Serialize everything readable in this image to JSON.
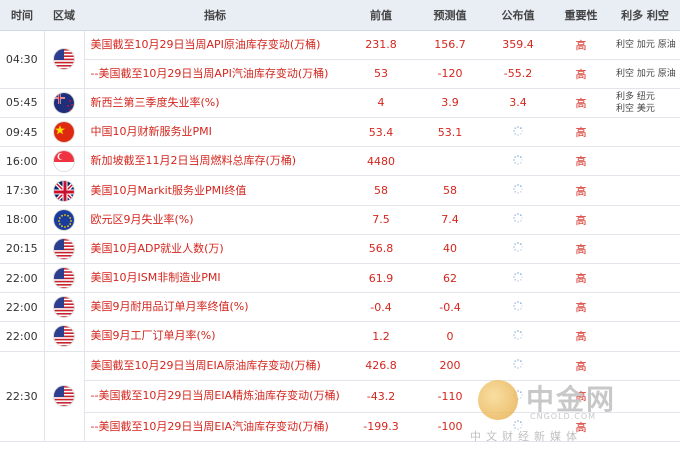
{
  "headers": [
    "时间",
    "区域",
    "指标",
    "前值",
    "预测值",
    "公布值",
    "重要性",
    "利多 利空"
  ],
  "rows": [
    {
      "time": "04:30",
      "flag": "us-flag-icon",
      "indicator": "美国截至10月29日当周API原油库存变动(万桶)",
      "prev": "231.8",
      "forecast": "156.7",
      "actual": "359.4",
      "importance": "高",
      "effect": "利空 加元 原油"
    },
    {
      "time": "",
      "flag": "",
      "indicator": "--美国截至10月29日当周API汽油库存变动(万桶)",
      "prev": "53",
      "forecast": "-120",
      "actual": "-55.2",
      "importance": "高",
      "effect": "利空 加元 原油"
    },
    {
      "time": "05:45",
      "flag": "nz-flag-icon",
      "indicator": "新西兰第三季度失业率(%)",
      "prev": "4",
      "forecast": "3.9",
      "actual": "3.4",
      "importance": "高",
      "effect": "利多 纽元\n利空 美元"
    },
    {
      "time": "09:45",
      "flag": "cn-flag-icon",
      "indicator": "中国10月财新服务业PMI",
      "prev": "53.4",
      "forecast": "53.1",
      "actual": "",
      "importance": "高",
      "effect": ""
    },
    {
      "time": "16:00",
      "flag": "sg-flag-icon",
      "indicator": "新加坡截至11月2日当周燃料总库存(万桶)",
      "prev": "4480",
      "forecast": "",
      "actual": "",
      "importance": "高",
      "effect": ""
    },
    {
      "time": "17:30",
      "flag": "uk-flag-icon",
      "indicator": "美国10月Markit服务业PMI终值",
      "prev": "58",
      "forecast": "58",
      "actual": "",
      "importance": "高",
      "effect": ""
    },
    {
      "time": "18:00",
      "flag": "eu-flag-icon",
      "indicator": "欧元区9月失业率(%)",
      "prev": "7.5",
      "forecast": "7.4",
      "actual": "",
      "importance": "高",
      "effect": ""
    },
    {
      "time": "20:15",
      "flag": "us-flag-icon",
      "indicator": "美国10月ADP就业人数(万)",
      "prev": "56.8",
      "forecast": "40",
      "actual": "",
      "importance": "高",
      "effect": ""
    },
    {
      "time": "22:00",
      "flag": "us-flag-icon",
      "indicator": "美国10月ISM非制造业PMI",
      "prev": "61.9",
      "forecast": "62",
      "actual": "",
      "importance": "高",
      "effect": ""
    },
    {
      "time": "22:00",
      "flag": "us-flag-icon",
      "indicator": "美国9月耐用品订单月率终值(%)",
      "prev": "-0.4",
      "forecast": "-0.4",
      "actual": "",
      "importance": "高",
      "effect": ""
    },
    {
      "time": "22:00",
      "flag": "us-flag-icon",
      "indicator": "美国9月工厂订单月率(%)",
      "prev": "1.2",
      "forecast": "0",
      "actual": "",
      "importance": "高",
      "effect": ""
    },
    {
      "time": "",
      "flag": "",
      "indicator": "美国截至10月29日当周EIA原油库存变动(万桶)",
      "prev": "426.8",
      "forecast": "200",
      "actual": "",
      "importance": "高",
      "effect": ""
    },
    {
      "time": "22:30",
      "flag": "us-flag-icon",
      "indicator": "--美国截至10月29日当周EIA精炼油库存变动(万桶)",
      "prev": "-43.2",
      "forecast": "-110",
      "actual": "",
      "importance": "高",
      "effect": ""
    },
    {
      "time": "",
      "flag": "",
      "indicator": "--美国截至10月29日当周EIA汽油库存变动(万桶)",
      "prev": "-199.3",
      "forecast": "-100",
      "actual": "",
      "importance": "高",
      "effect": ""
    }
  ],
  "watermark": {
    "name": "中金网",
    "url": "CNGOLD.COM",
    "sub": "中文财经新媒体"
  }
}
